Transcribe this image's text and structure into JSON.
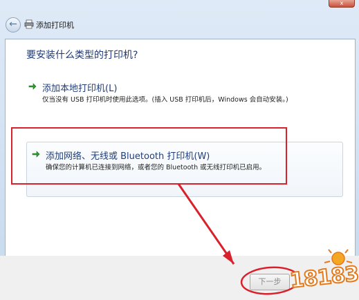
{
  "window": {
    "title": "添加打印机",
    "close_glyph": "x"
  },
  "content": {
    "heading": "要安装什么类型的打印机?",
    "options": [
      {
        "title": "添加本地打印机(L)",
        "description": "仅当没有 USB 打印机时使用此选项。(插入 USB 打印机后，Windows 会自动安装。)"
      },
      {
        "title": "添加网络、无线或 Bluetooth 打印机(W)",
        "description": "确保您的计算机已连接到网络，或者您的 Bluetooth 或无线打印机已启用。"
      }
    ]
  },
  "footer": {
    "next_label": "下一步",
    "next_enabled": false
  },
  "watermark": {
    "text": "18183"
  },
  "colors": {
    "highlight": "#d8212b",
    "heading": "#1e3a78",
    "arrow_green": "#2f9a2f",
    "logo_orange": "#e47a1a"
  },
  "icons": {
    "back": "back-arrow-icon",
    "printer": "printer-icon",
    "option_arrow": "green-arrow-icon"
  }
}
